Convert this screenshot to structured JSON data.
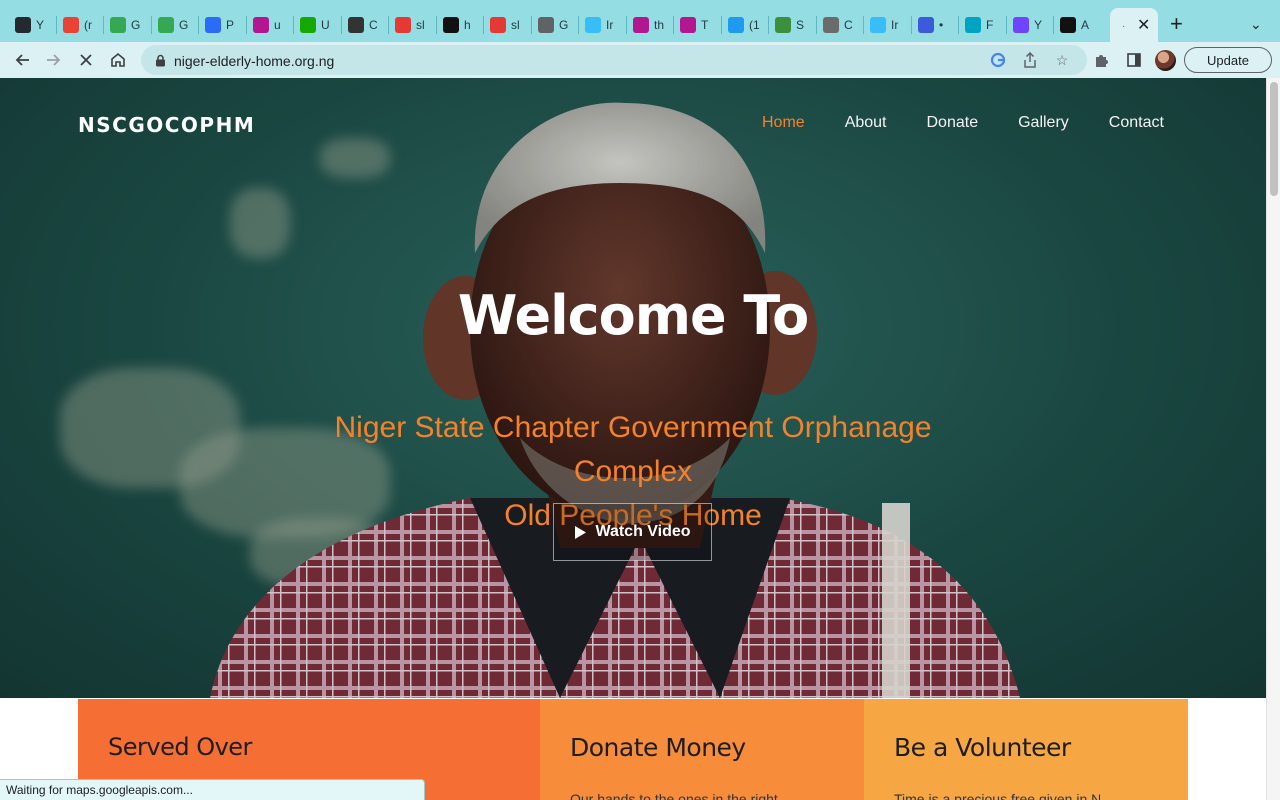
{
  "browser": {
    "tabs": [
      {
        "icon": "github-icon",
        "label": "Y",
        "color": "#24292f"
      },
      {
        "icon": "gmail-icon",
        "label": "(r",
        "color": "#ea4335"
      },
      {
        "icon": "google-meet-icon",
        "label": "G",
        "color": "#34a853"
      },
      {
        "icon": "google-meet-icon",
        "label": "G",
        "color": "#34a853"
      },
      {
        "icon": "zoho-icon",
        "label": "P",
        "color": "#2a6df4"
      },
      {
        "icon": "webflow-icon",
        "label": "u",
        "color": "#b3178f"
      },
      {
        "icon": "upwork-icon",
        "label": "U",
        "color": "#14a800"
      },
      {
        "icon": "notion-icon",
        "label": "C",
        "color": "#333333"
      },
      {
        "icon": "slides-icon",
        "label": "sl",
        "color": "#e53935"
      },
      {
        "icon": "vercel-icon",
        "label": "h",
        "color": "#111111"
      },
      {
        "icon": "slides-icon",
        "label": "sl",
        "color": "#e53935"
      },
      {
        "icon": "globe-icon",
        "label": "G",
        "color": "#5f6368"
      },
      {
        "icon": "tailwind-icon",
        "label": "Ir",
        "color": "#38bdf8"
      },
      {
        "icon": "webflow-icon",
        "label": "th",
        "color": "#b3178f"
      },
      {
        "icon": "webflow-icon",
        "label": "T",
        "color": "#b3178f"
      },
      {
        "icon": "twitter-icon",
        "label": "(1",
        "color": "#1d9bf0"
      },
      {
        "icon": "money-icon",
        "label": "S",
        "color": "#3c8f3c"
      },
      {
        "icon": "openai-icon",
        "label": "C",
        "color": "#6b6b6b"
      },
      {
        "icon": "tailwind-icon",
        "label": "Ir",
        "color": "#38bdf8"
      },
      {
        "icon": "record-icon",
        "label": "•",
        "color": "#3b5bdb"
      },
      {
        "icon": "canva-icon",
        "label": "F",
        "color": "#00a3c4"
      },
      {
        "icon": "heart-message-icon",
        "label": "Y",
        "color": "#6e44ff"
      },
      {
        "icon": "vercel-icon",
        "label": "A",
        "color": "#111111"
      }
    ],
    "active_tab_loading": "·",
    "url": "niger-elderly-home.org.ng",
    "update_label": "Update",
    "status_text": "Waiting for maps.googleapis.com..."
  },
  "site": {
    "logo": "NSCGOCOPHM",
    "nav": [
      {
        "label": "Home",
        "active": true
      },
      {
        "label": "About",
        "active": false
      },
      {
        "label": "Donate",
        "active": false
      },
      {
        "label": "Gallery",
        "active": false
      },
      {
        "label": "Contact",
        "active": false
      }
    ],
    "hero": {
      "title": "Welcome To",
      "subtitle_line1": "Niger State Chapter Government Orphanage Complex",
      "subtitle_line2": "Old People's Home",
      "cta_label": "Watch Video"
    },
    "cards": [
      {
        "title": "Served Over",
        "body": ""
      },
      {
        "title": "Donate Money",
        "body": "Our hands to the ones in the right"
      },
      {
        "title": "Be a Volunteer",
        "body": "Time is a precious free given in N"
      }
    ]
  },
  "colors": {
    "accent": "#f5822a",
    "card_served": "#f56e33",
    "card_donate": "#f78c3b",
    "card_volunteer": "#f6a744",
    "browser_chrome": "#94dde3"
  }
}
